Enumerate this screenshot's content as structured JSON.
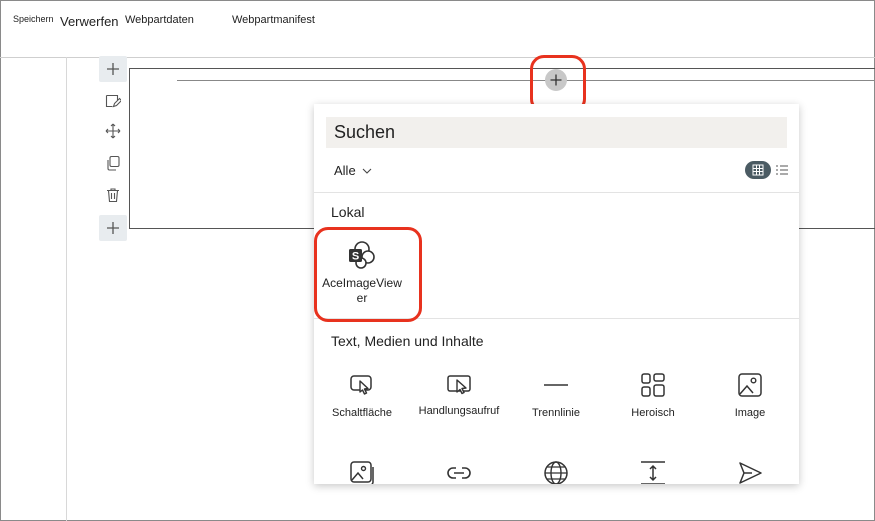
{
  "toolbar": {
    "save_label": "Speichern",
    "discard_label": "Verwerfen",
    "webpart_data_label": "Webpartdaten",
    "webpart_manifest_label": "Webpartmanifest"
  },
  "picker": {
    "search_placeholder": "Suchen",
    "filter_label": "Alle",
    "local_group_title": "Lokal",
    "local_items": [
      {
        "label_line1": "AceImageView",
        "label_line2": "er",
        "icon": "sharepoint-icon"
      }
    ],
    "media_group_title": "Text, Medien und Inhalte",
    "media_items": [
      {
        "label": "Schaltfläche",
        "icon": "button-icon"
      },
      {
        "label": "Handlungsaufruf",
        "icon": "call-to-action-icon"
      },
      {
        "label": "Trennlinie",
        "icon": "divider-icon"
      },
      {
        "label": "Heroisch",
        "icon": "hero-icon"
      },
      {
        "label": "Image",
        "icon": "image-icon"
      }
    ],
    "more_item_icons": [
      "image-gallery-icon",
      "link-icon",
      "globe-icon",
      "spacer-icon",
      "send-icon"
    ]
  },
  "colors": {
    "highlight": "#e8321e",
    "toggle_bg": "#4b5b63"
  }
}
